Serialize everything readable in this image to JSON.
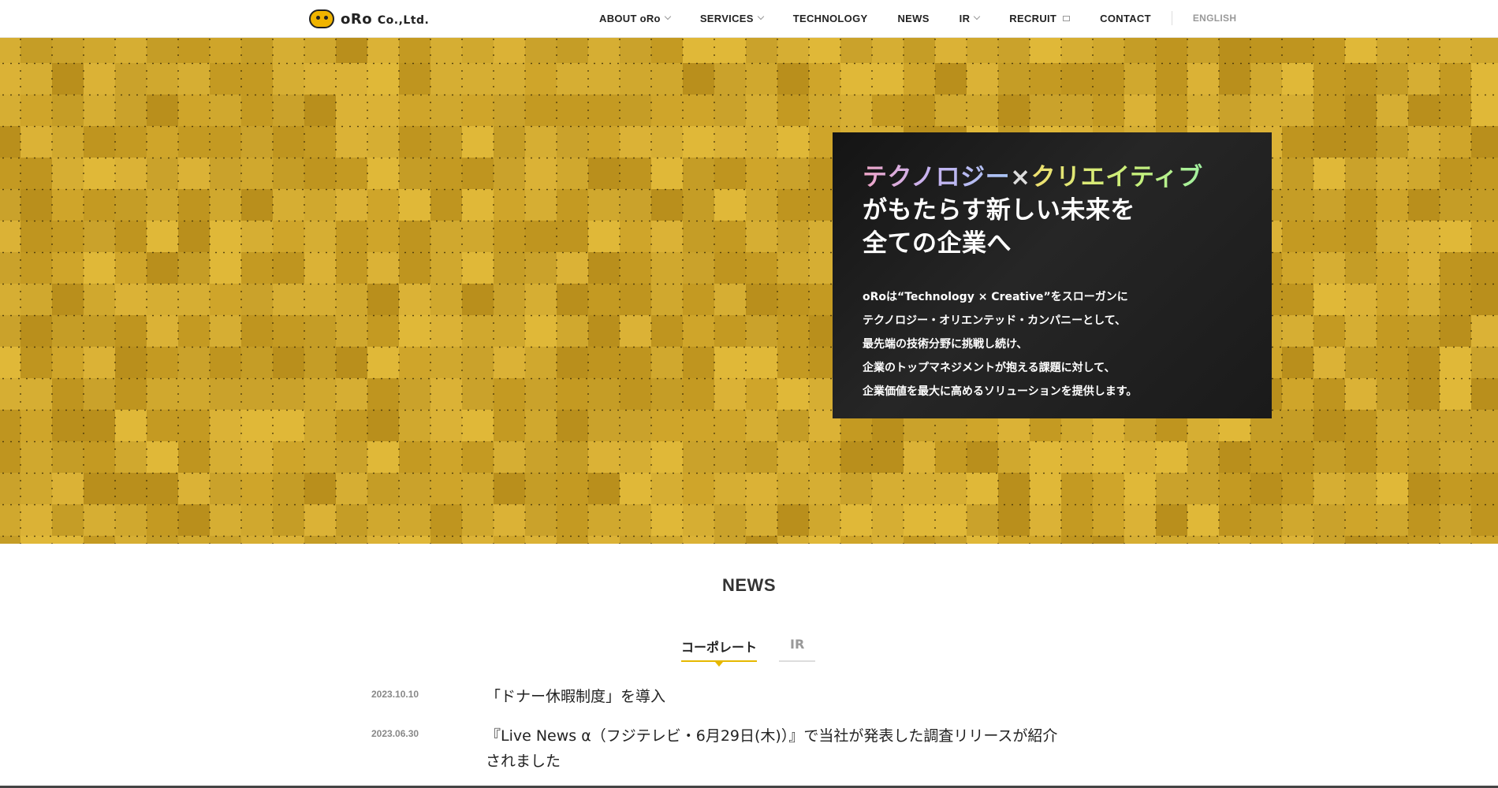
{
  "brand": {
    "logo_text": "oRo",
    "logo_suffix": "Co.,Ltd."
  },
  "nav": {
    "items": [
      {
        "label": "ABOUT oRo",
        "dropdown": true
      },
      {
        "label": "SERVICES",
        "dropdown": true
      },
      {
        "label": "TECHNOLOGY",
        "dropdown": false
      },
      {
        "label": "NEWS",
        "dropdown": false
      },
      {
        "label": "IR",
        "dropdown": true
      },
      {
        "label": "RECRUIT",
        "external": true
      },
      {
        "label": "CONTACT",
        "dropdown": false
      }
    ],
    "language": "ENGLISH"
  },
  "hero": {
    "headline_part1": "テクノロジー",
    "headline_times": "×",
    "headline_part2": "クリエイティブ",
    "headline_line2": "がもたらす新しい未来を",
    "headline_line3": "全ての企業へ",
    "body": [
      "oRoは“Technology × Creative”をスローガンに",
      "テクノロジー・オリエンテッド・カンパニーとして、",
      "最先端の技術分野に挑戦し続け、",
      "企業のトップマネジメントが抱える課題に対して、",
      "企業価値を最大に高めるソリューションを提供します。"
    ],
    "colors": {
      "background": "#c9a02a",
      "box": "#1c1c1c"
    }
  },
  "news": {
    "title": "NEWS",
    "tabs": [
      {
        "label": "コーポレート",
        "active": true
      },
      {
        "label": "IR",
        "active": false
      }
    ],
    "items": [
      {
        "date": "2023.10.10",
        "title": "「ドナー休暇制度」を導入"
      },
      {
        "date": "2023.06.30",
        "title": "『Live News α（フジテレビ・6月29日(木)）』で当社が発表した調査リリースが紹介されました"
      }
    ]
  },
  "colors": {
    "accent": "#e6b800"
  }
}
